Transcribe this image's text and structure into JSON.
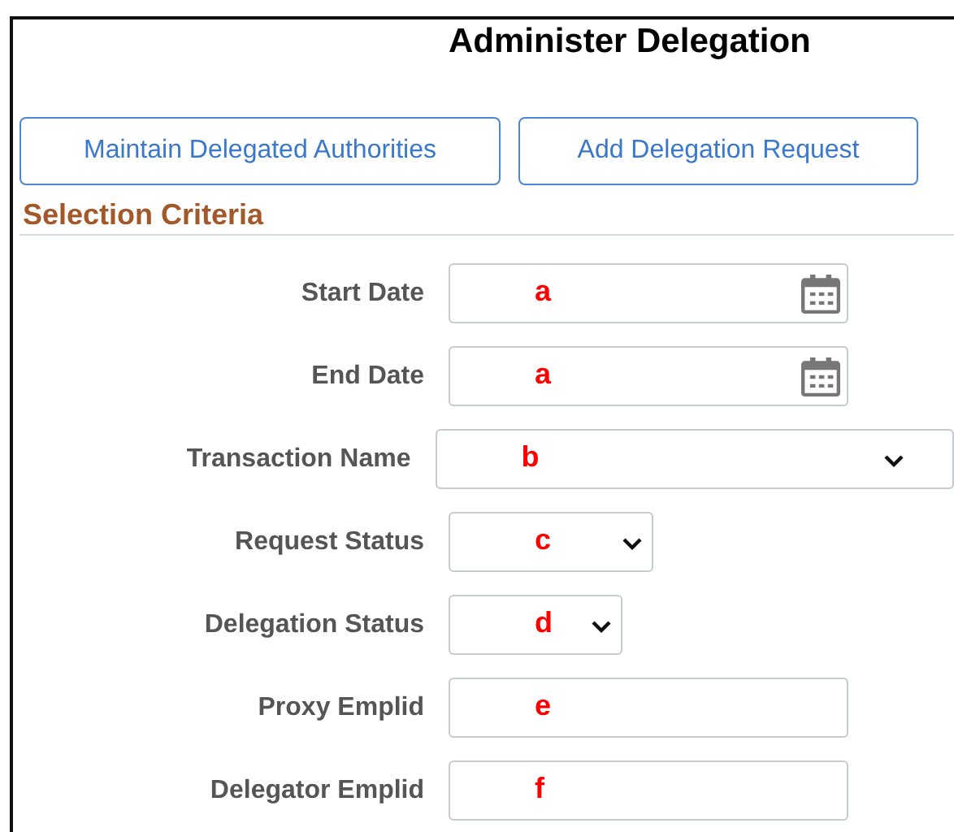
{
  "title": "Administer Delegation",
  "buttons": [
    "Maintain Delegated Authorities",
    "Add Delegation Request"
  ],
  "section": "Selection Criteria",
  "fields": [
    {
      "label": "Start Date",
      "kind": "date",
      "annotation": "a"
    },
    {
      "label": "End Date",
      "kind": "date",
      "annotation": "a"
    },
    {
      "label": "Transaction Name",
      "kind": "select",
      "annotation": "b"
    },
    {
      "label": "Request Status",
      "kind": "select",
      "annotation": "c"
    },
    {
      "label": "Delegation Status",
      "kind": "select",
      "annotation": "d"
    },
    {
      "label": "Proxy Emplid",
      "kind": "text",
      "annotation": "e"
    },
    {
      "label": "Delegator Emplid",
      "kind": "text",
      "annotation": "f"
    }
  ]
}
